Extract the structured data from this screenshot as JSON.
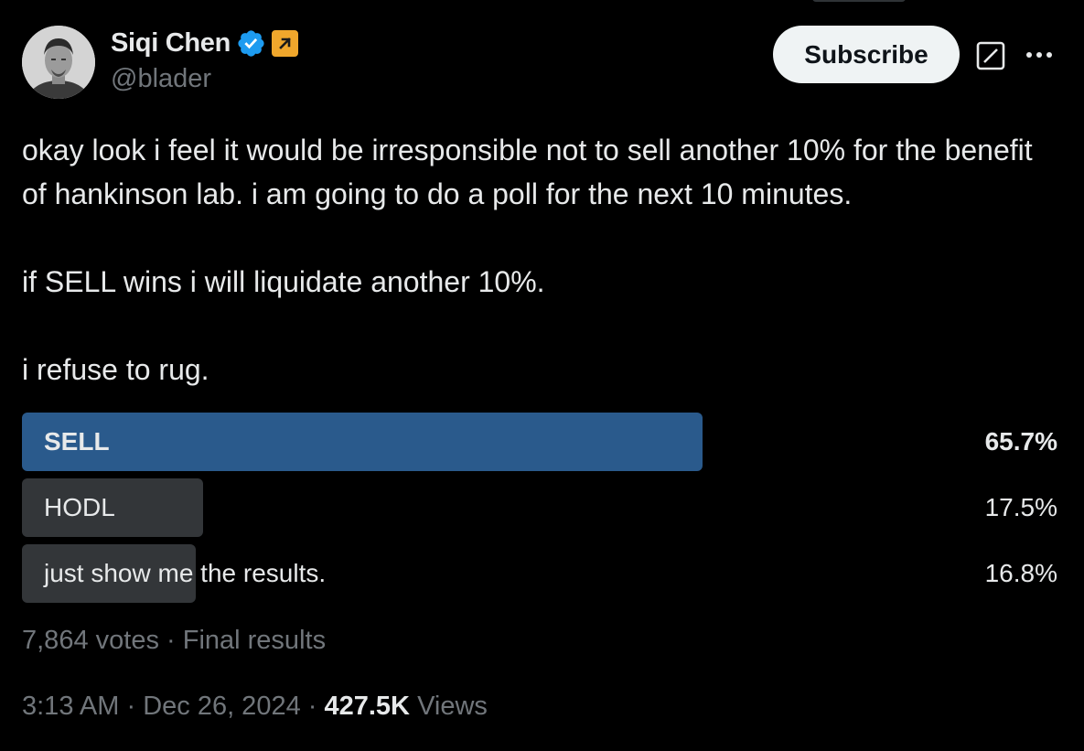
{
  "author": {
    "name": "Siqi Chen",
    "handle": "@blader",
    "verified_color": "#1d9bf0",
    "affiliate_color": "#f0a72c"
  },
  "actions": {
    "subscribe_label": "Subscribe",
    "grok_icon": "grok-icon",
    "more_icon": "more-icon"
  },
  "tweet": {
    "line1": "okay look i feel it would be irresponsible not to sell another 10% for the benefit of hankinson lab. i am going to do a poll for the next 10 minutes.",
    "line2": "if SELL wins i will liquidate another 10%.",
    "line3": "i refuse to rug."
  },
  "poll": {
    "options": [
      {
        "label": "SELL",
        "percent_text": "65.7%",
        "percent": 65.7,
        "winner": true,
        "bar_color": "#2a5a8c"
      },
      {
        "label": "HODL",
        "percent_text": "17.5%",
        "percent": 17.5,
        "winner": false,
        "bar_color": "#333639"
      },
      {
        "label": "just show me the results.",
        "percent_text": "16.8%",
        "percent": 16.8,
        "winner": false,
        "bar_color": "#333639"
      }
    ],
    "votes": "7,864 votes",
    "status": "Final results"
  },
  "meta": {
    "time": "3:13 AM",
    "date": "Dec 26, 2024",
    "views_count": "427.5K",
    "views_label": "Views"
  }
}
